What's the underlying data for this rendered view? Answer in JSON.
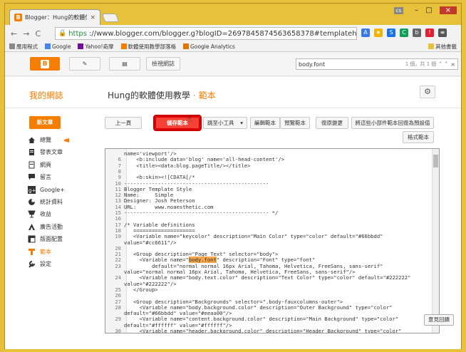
{
  "browser": {
    "tab_title": "Blogger：Hung的軟體使",
    "tab_icon": "B",
    "tab_close": "×",
    "user_badge": "cs",
    "win_min": "–",
    "win_max": "□",
    "win_close": "×",
    "nav_back": "←",
    "nav_forward": "→",
    "nav_reload": "C",
    "url_scheme": "https",
    "url_rest": "://www.blogger.com/blogger.g?blogID=2697845874563658378#templateh",
    "bookmarks": [
      "應用程式",
      "Google",
      "Yahoo!奇摩",
      "軟體使用教學部落格",
      "Google Analytics"
    ],
    "other_bookmarks": "其他書籤"
  },
  "blogger_bar": {
    "view_blog": "檢視網誌",
    "find_value": "body.font",
    "find_count": "1 個，共 1 個"
  },
  "header": {
    "my_blogs": "我的網誌",
    "blog_title": "Hung的軟體使用教學",
    "separator": "·",
    "subtitle": "範本"
  },
  "sidebar": {
    "new_post": "新文章",
    "items": [
      {
        "label": "總覽",
        "icon": "home-icon"
      },
      {
        "label": "發表文章",
        "icon": "posts-icon"
      },
      {
        "label": "網頁",
        "icon": "pages-icon"
      },
      {
        "label": "留言",
        "icon": "comments-icon"
      },
      {
        "label": "Google+",
        "icon": "googleplus-icon"
      },
      {
        "label": "統計資料",
        "icon": "stats-icon"
      },
      {
        "label": "收益",
        "icon": "earnings-icon"
      },
      {
        "label": "廣告活動",
        "icon": "campaigns-icon"
      },
      {
        "label": "版面配置",
        "icon": "layout-icon"
      },
      {
        "label": "範本",
        "icon": "template-icon"
      },
      {
        "label": "設定",
        "icon": "settings-icon"
      }
    ]
  },
  "toolbar": {
    "prev": "上一頁",
    "save": "儲存範本",
    "jump_widget": "跳至小工具",
    "edit_template": "編輯範本",
    "preview": "預覽範本",
    "revert": "復原變更",
    "revert_widgets": "將這些小部件範本回復為預設值",
    "format": "格式範本"
  },
  "editor": {
    "lines": [
      {
        "n": "",
        "t": "name='viewport'/>"
      },
      {
        "n": "6",
        "t": "    <b:include data='blog' name='all-head-content'/>"
      },
      {
        "n": "7",
        "t": "    <title><data:blog.pageTitle/></title>"
      },
      {
        "n": "8",
        "t": ""
      },
      {
        "n": "9",
        "t": "    <b:skin><![CDATA[/*"
      },
      {
        "n": "10",
        "t": "-----------------------------------------------"
      },
      {
        "n": "11",
        "t": "Blogger Template Style"
      },
      {
        "n": "12",
        "t": "Name:     Simple"
      },
      {
        "n": "13",
        "t": "Designer: Josh Peterson"
      },
      {
        "n": "14",
        "t": "URL:      www.noaesthetic.com"
      },
      {
        "n": "15",
        "t": "----------------------------------------------- */"
      },
      {
        "n": "16",
        "t": ""
      },
      {
        "n": "17",
        "t": "/* Variable definitions"
      },
      {
        "n": "18",
        "t": "   ===================="
      },
      {
        "n": "19",
        "t": "   <Variable name=\"keycolor\" description=\"Main Color\" type=\"color\" default=\"#66bbdd\""
      },
      {
        "n": "",
        "t": "value=\"#cc6611\"/>"
      },
      {
        "n": "20",
        "t": ""
      },
      {
        "n": "21",
        "t": "   <Group description=\"Page Text\" selector=\"body\">"
      },
      {
        "n": "22",
        "t": "     <Variable name=\"body.font\" description=\"Font\" type=\"font\""
      },
      {
        "n": "23",
        "t": "         default=\"normal normal 16px Arial, Tahoma, Helvetica, FreeSans, sans-serif\""
      },
      {
        "n": "",
        "t": "value=\"normal normal 16px Arial, Tahoma, Helvetica, FreeSans, sans-serif\"/>"
      },
      {
        "n": "24",
        "t": "     <Variable name=\"body.text.color\" description=\"Text Color\" type=\"color\" default=\"#222222\""
      },
      {
        "n": "",
        "t": "value=\"#222222\"/>"
      },
      {
        "n": "25",
        "t": "   </Group>"
      },
      {
        "n": "26",
        "t": ""
      },
      {
        "n": "27",
        "t": "   <Group description=\"Backgrounds\" selector=\".body-fauxcolumns-outer\">"
      },
      {
        "n": "28",
        "t": "     <Variable name=\"body.background.color\" description=\"Outer Background\" type=\"color\""
      },
      {
        "n": "",
        "t": "default=\"#66bbdd\" value=\"#eeaa00\"/>"
      },
      {
        "n": "29",
        "t": "     <Variable name=\"content.background.color\" description=\"Main Background\" type=\"color\""
      },
      {
        "n": "",
        "t": "default=\"#ffffff\" value=\"#ffffff\"/>"
      },
      {
        "n": "30",
        "t": "     <Variable name=\"header.background.color\" description=\"Header Background\" type=\"color\""
      }
    ],
    "highlight": "body.font"
  },
  "feedback": "意見回饋",
  "colors": {
    "accent": "#f57d00",
    "save_red": "#f44336",
    "frame": "#e8c13a"
  }
}
